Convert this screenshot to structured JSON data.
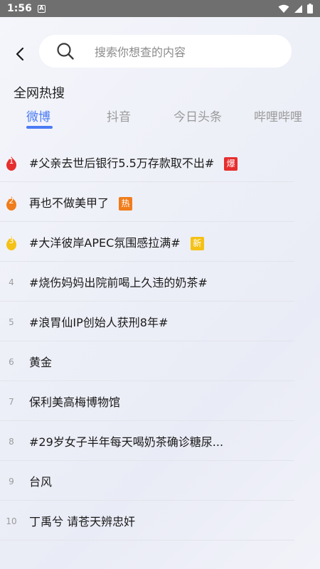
{
  "status": {
    "time": "1:56",
    "a_label": "A"
  },
  "search": {
    "placeholder": "搜索你想查的内容"
  },
  "section_title": "全网热搜",
  "tabs": [
    {
      "label": "微博",
      "active": true
    },
    {
      "label": "抖音",
      "active": false
    },
    {
      "label": "今日头条",
      "active": false
    },
    {
      "label": "哔哩哔哩",
      "active": false
    }
  ],
  "hot_list": [
    {
      "rank": "1",
      "title": "#父亲去世后银行5.5万存款取不出#",
      "tag": "爆"
    },
    {
      "rank": "2",
      "title": "再也不做美甲了",
      "tag": "热"
    },
    {
      "rank": "3",
      "title": "#大洋彼岸APEC氛围感拉满#",
      "tag": "新"
    },
    {
      "rank": "4",
      "title": "#烧伤妈妈出院前喝上久违的奶茶#",
      "tag": ""
    },
    {
      "rank": "5",
      "title": "#浪胃仙IP创始人获刑8年#",
      "tag": ""
    },
    {
      "rank": "6",
      "title": "黄金",
      "tag": ""
    },
    {
      "rank": "7",
      "title": "保利美高梅博物馆",
      "tag": ""
    },
    {
      "rank": "8",
      "title": " #29岁女子半年每天喝奶茶确诊糖尿...",
      "tag": ""
    },
    {
      "rank": "9",
      "title": "台风",
      "tag": ""
    },
    {
      "rank": "10",
      "title": "丁禹兮 请苍天辨忠奸",
      "tag": ""
    }
  ],
  "colors": {
    "accent": "#4a7af5",
    "rank1": "#e62e2e",
    "rank2": "#f07c1b",
    "rank3": "#f5c116"
  }
}
